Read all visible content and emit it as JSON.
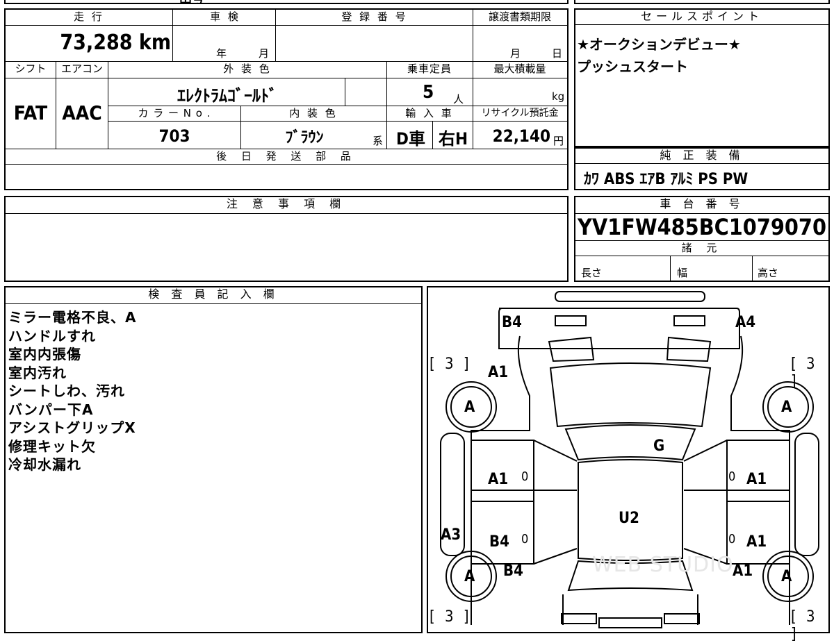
{
  "top_fragment": "田号",
  "table": {
    "mileage_label": "走 行",
    "mileage_value": "73,288 km",
    "inspection_label": "車 検",
    "inspection_year": "年",
    "inspection_month": "月",
    "registration_label": "登 録 番 号",
    "transfer_label": "譲渡書類期限",
    "transfer_month": "月",
    "transfer_day": "日",
    "shift_label": "シフト",
    "shift_value": "FAT",
    "ac_label": "エアコン",
    "ac_value": "AAC",
    "exterior_color_label": "外 装 色",
    "exterior_color_value": "ｴﾚｸﾄﾗﾑｺﾞｰﾙﾄﾞ",
    "capacity_label": "乗車定員",
    "capacity_value": "5",
    "capacity_unit": "人",
    "max_load_label": "最大積載量",
    "max_load_unit": "kg",
    "color_no_label": "カ ラ ー N o .",
    "color_no_value": "703",
    "interior_color_label": "内 装 色",
    "interior_color_value": "ﾌﾞﾗｳﾝ",
    "interior_suffix": "系",
    "import_label": "輸 入 車",
    "import_type": "D車",
    "steering": "右H",
    "recycle_label": "リサイクル預託金",
    "recycle_value": "22,140",
    "recycle_unit": "円",
    "later_parts_label": "後 日 発 送 部 品",
    "notes_label": "注 意 事 項 欄"
  },
  "sales_point": {
    "label": "セールスポイント",
    "lines": [
      "★オークションデビュー★",
      "プッシュスタート"
    ]
  },
  "equipment": {
    "label": "純 正 装 備",
    "value": "ｶﾜ ABS ｴｱB ｱﾙﾐ PS PW"
  },
  "vin": {
    "label": "車 台 番 号",
    "value": "YV1FW485BC1079070"
  },
  "specs": {
    "label": "諸 元",
    "length": "長さ",
    "width": "幅",
    "height": "高さ"
  },
  "inspector": {
    "label": "検 査 員 記 入 欄",
    "notes": [
      "ミラー電格不良、A",
      "ハンドルすれ",
      "室内内張傷",
      "室内汚れ",
      "シートしわ、汚れ",
      "バンパー下A",
      "アシストグリップX",
      "修理キット欠",
      "冷却水漏れ"
    ]
  },
  "diagram": {
    "tire_bracket": "[ 3 ]",
    "tire_grade": "A",
    "labels": {
      "front_left": "B4",
      "front_right": "A4",
      "fender_left": "A1",
      "windshield": "G",
      "front_door_left": "A1",
      "front_door_right": "A1",
      "roof": "U2",
      "rear_door_left": "B4",
      "rear_door_right": "A1",
      "quarter_left": "B4",
      "quarter_right": "A1",
      "sill_left": "A3",
      "zero": "0"
    },
    "watermark": "WEB STUDIO"
  }
}
